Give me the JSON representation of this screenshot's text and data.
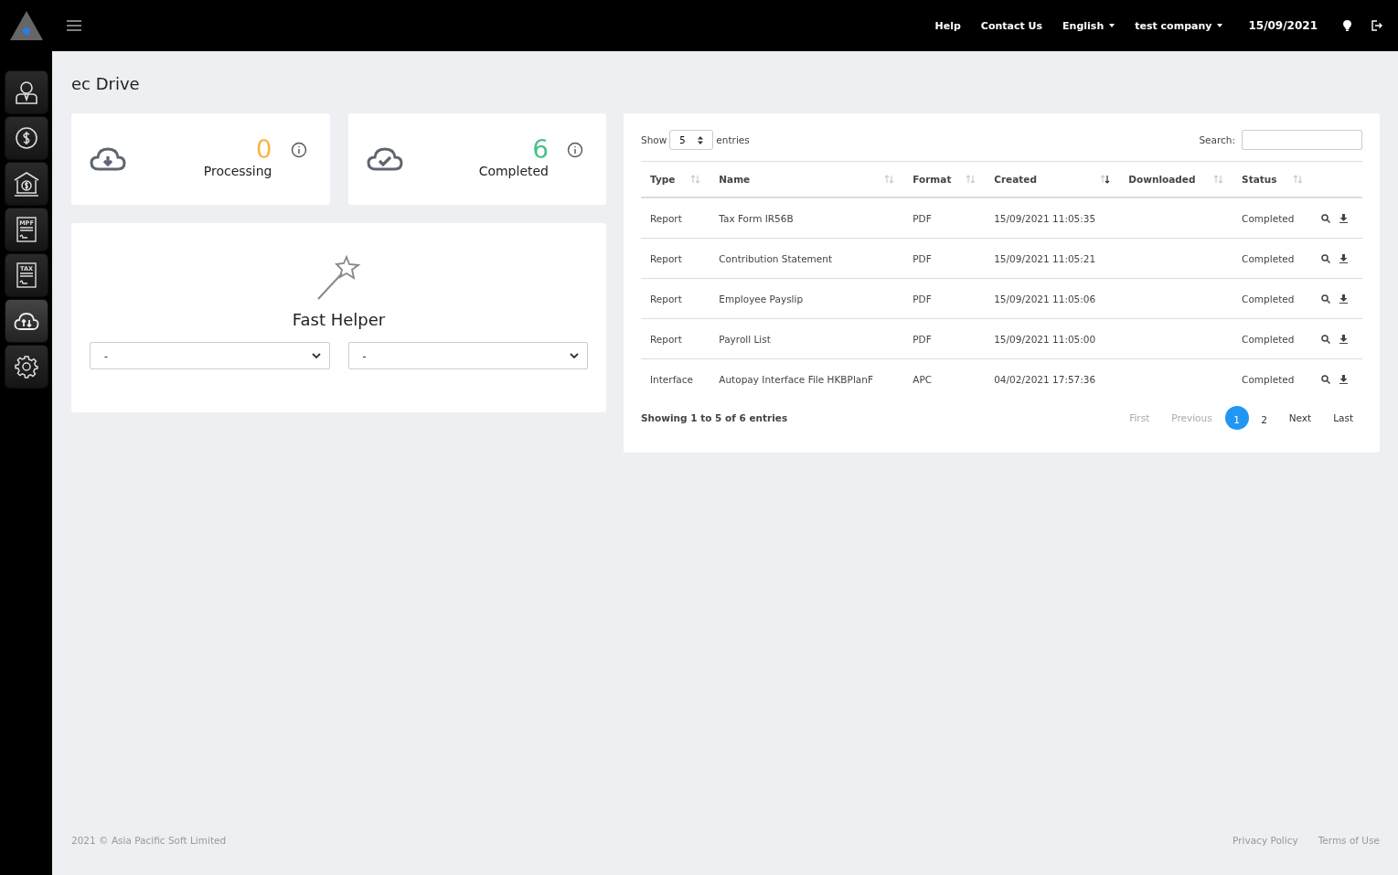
{
  "topbar": {
    "links": [
      {
        "label": "Help",
        "dropdown": false
      },
      {
        "label": "Contact Us",
        "dropdown": false
      },
      {
        "label": "English",
        "dropdown": true
      },
      {
        "label": "test company",
        "dropdown": true
      }
    ],
    "date": "15/09/2021"
  },
  "sidebar": {
    "items": [
      {
        "kind": "person",
        "selected": false
      },
      {
        "kind": "dollar",
        "selected": false
      },
      {
        "kind": "bank",
        "selected": false
      },
      {
        "kind": "doc",
        "label": "MPF",
        "selected": false
      },
      {
        "kind": "doc",
        "label": "TAX",
        "selected": false
      },
      {
        "kind": "cloud",
        "selected": true
      },
      {
        "kind": "gear",
        "selected": false
      }
    ]
  },
  "page_title": "ec Drive",
  "stats": [
    {
      "kind": "download",
      "value": "0",
      "label": "Processing",
      "color": "#f5b84a"
    },
    {
      "kind": "check",
      "value": "6",
      "label": "Completed",
      "color": "#4cc08a"
    }
  ],
  "fast_helper": {
    "title": "Fast Helper",
    "selects": [
      "-",
      "-"
    ]
  },
  "table": {
    "show_label": "Show",
    "page_size": "5",
    "entries_label": "entries",
    "search_label": "Search:",
    "columns": [
      {
        "label": "Type",
        "sorted": false
      },
      {
        "label": "Name",
        "sorted": false
      },
      {
        "label": "Format",
        "sorted": false
      },
      {
        "label": "Created",
        "sorted": true
      },
      {
        "label": "Downloaded",
        "sorted": false
      },
      {
        "label": "Status",
        "sorted": false
      }
    ],
    "rows": [
      {
        "type": "Report",
        "name": "Tax Form IR56B",
        "format": "PDF",
        "created": "15/09/2021 11:05:35",
        "status": "Completed"
      },
      {
        "type": "Report",
        "name": "Contribution Statement",
        "format": "PDF",
        "created": "15/09/2021 11:05:21",
        "status": "Completed"
      },
      {
        "type": "Report",
        "name": "Employee Payslip",
        "format": "PDF",
        "created": "15/09/2021 11:05:06",
        "status": "Completed"
      },
      {
        "type": "Report",
        "name": "Payroll List",
        "format": "PDF",
        "created": "15/09/2021 11:05:00",
        "status": "Completed"
      },
      {
        "type": "Interface",
        "name": "Autopay Interface File HKBPlanF",
        "format": "APC",
        "created": "04/02/2021 17:57:36",
        "status": "Completed"
      }
    ],
    "info": "Showing 1 to 5 of 6 entries",
    "pages": [
      {
        "label": "First",
        "kind": "link",
        "disabled": true,
        "selected": false
      },
      {
        "label": "Previous",
        "kind": "link",
        "disabled": true,
        "selected": false
      },
      {
        "label": "1",
        "kind": "number",
        "disabled": false,
        "selected": true
      },
      {
        "label": "2",
        "kind": "number",
        "disabled": false,
        "selected": false
      },
      {
        "label": "Next",
        "kind": "link",
        "disabled": false,
        "selected": false
      },
      {
        "label": "Last",
        "kind": "link",
        "disabled": false,
        "selected": false
      }
    ]
  },
  "footer": {
    "copyright": "2021 © Asia Pacific Soft Limited",
    "links": [
      "Privacy Policy",
      "Terms of Use"
    ]
  }
}
